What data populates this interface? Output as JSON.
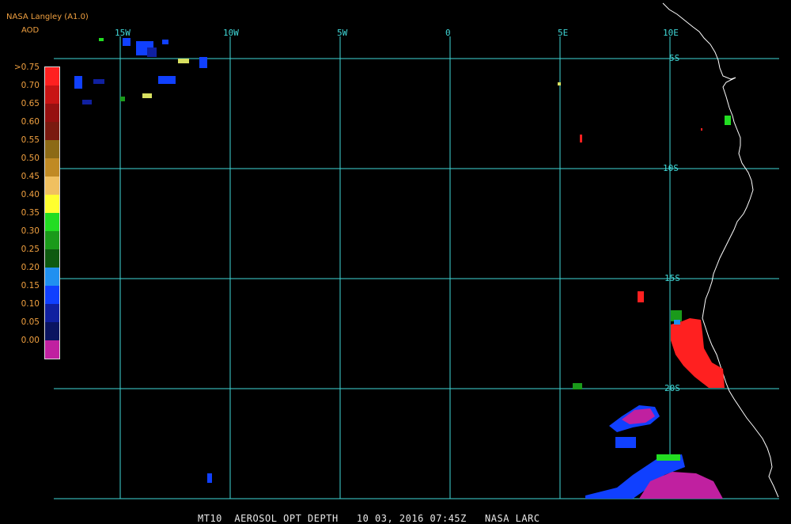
{
  "legend": {
    "source": "NASA Langley (A1.0)",
    "unit": "AOD",
    "labels": [
      ">0.75",
      "0.70",
      "0.65",
      "0.60",
      "0.55",
      "0.50",
      "0.45",
      "0.40",
      "0.35",
      "0.30",
      "0.25",
      "0.20",
      "0.15",
      "0.10",
      "0.05",
      "0.00"
    ],
    "colors": [
      "#ff2020",
      "#c81414",
      "#961010",
      "#7a1a10",
      "#8c6a16",
      "#c08a24",
      "#f0c060",
      "#ffff30",
      "#22dd22",
      "#1a9a1a",
      "#0e5a10",
      "#2090f0",
      "#1040ff",
      "#1020a0",
      "#0a1460",
      "#c020a0"
    ]
  },
  "map": {
    "longitude_labels": [
      "15W",
      "10W",
      "5W",
      "0",
      "5E",
      "10E"
    ],
    "latitude_labels": [
      "5S",
      "10S",
      "15S",
      "20S"
    ]
  },
  "caption": {
    "text": "MT10  AEROSOL OPT DEPTH   10 03, 2016 07:45Z   NASA LARC"
  },
  "colors": {
    "grid": "#40d8d8",
    "coast": "#ffffff",
    "label": "#f0a040"
  }
}
